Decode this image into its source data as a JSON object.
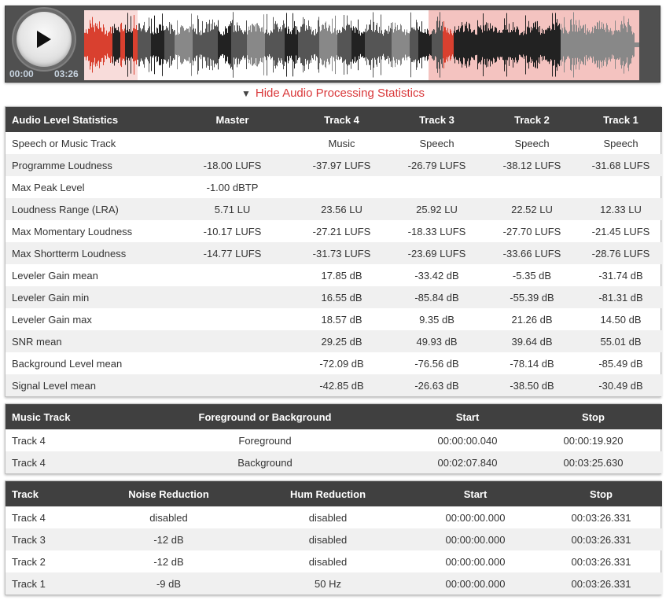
{
  "player": {
    "current_time": "00:00",
    "duration": "03:26",
    "play_icon": "play-icon",
    "colors": {
      "background": "#505050",
      "highlight": "#f4c3c0",
      "highlight_light": "#f8dcda",
      "wave_red": "#d9402f",
      "wave_dark": "#222222",
      "wave_mid": "#555555",
      "wave_light": "#888888"
    }
  },
  "toggle": {
    "icon": "triangle-down-icon",
    "label": "Hide Audio Processing Statistics",
    "color": "#d9383a"
  },
  "level_stats": {
    "headers": [
      "Audio Level Statistics",
      "Master",
      "Track 4",
      "Track 3",
      "Track 2",
      "Track 1"
    ],
    "rows": [
      [
        "Speech or Music Track",
        "",
        "Music",
        "Speech",
        "Speech",
        "Speech"
      ],
      [
        "Programme Loudness",
        "-18.00 LUFS",
        "-37.97 LUFS",
        "-26.79 LUFS",
        "-38.12 LUFS",
        "-31.68 LUFS"
      ],
      [
        "Max Peak Level",
        "-1.00 dBTP",
        "",
        "",
        "",
        ""
      ],
      [
        "Loudness Range (LRA)",
        "5.71 LU",
        "23.56 LU",
        "25.92 LU",
        "22.52 LU",
        "12.33 LU"
      ],
      [
        "Max Momentary Loudness",
        "-10.17 LUFS",
        "-27.21 LUFS",
        "-18.33 LUFS",
        "-27.70 LUFS",
        "-21.45 LUFS"
      ],
      [
        "Max Shortterm Loudness",
        "-14.77 LUFS",
        "-31.73 LUFS",
        "-23.69 LUFS",
        "-33.66 LUFS",
        "-28.76 LUFS"
      ],
      [
        "Leveler Gain mean",
        "",
        "17.85 dB",
        "-33.42 dB",
        "-5.35 dB",
        "-31.74 dB"
      ],
      [
        "Leveler Gain min",
        "",
        "16.55 dB",
        "-85.84 dB",
        "-55.39 dB",
        "-81.31 dB"
      ],
      [
        "Leveler Gain max",
        "",
        "18.57 dB",
        "9.35 dB",
        "21.26 dB",
        "14.50 dB"
      ],
      [
        "SNR mean",
        "",
        "29.25 dB",
        "49.93 dB",
        "39.64 dB",
        "55.01 dB"
      ],
      [
        "Background Level mean",
        "",
        "-72.09 dB",
        "-76.56 dB",
        "-78.14 dB",
        "-85.49 dB"
      ],
      [
        "Signal Level mean",
        "",
        "-42.85 dB",
        "-26.63 dB",
        "-38.50 dB",
        "-30.49 dB"
      ]
    ]
  },
  "music_tracks": {
    "headers": [
      "Music Track",
      "Foreground or Background",
      "Start",
      "Stop"
    ],
    "rows": [
      [
        "Track 4",
        "Foreground",
        "00:00:00.040",
        "00:00:19.920"
      ],
      [
        "Track 4",
        "Background",
        "00:02:07.840",
        "00:03:25.630"
      ]
    ]
  },
  "processing": {
    "headers": [
      "Track",
      "Noise Reduction",
      "Hum Reduction",
      "Start",
      "Stop"
    ],
    "rows": [
      [
        "Track 4",
        "disabled",
        "disabled",
        "00:00:00.000",
        "00:03:26.331"
      ],
      [
        "Track 3",
        "-12 dB",
        "disabled",
        "00:00:00.000",
        "00:03:26.331"
      ],
      [
        "Track 2",
        "-12 dB",
        "disabled",
        "00:00:00.000",
        "00:03:26.331"
      ],
      [
        "Track 1",
        "-9 dB",
        "50 Hz",
        "00:00:00.000",
        "00:03:26.331"
      ]
    ]
  }
}
